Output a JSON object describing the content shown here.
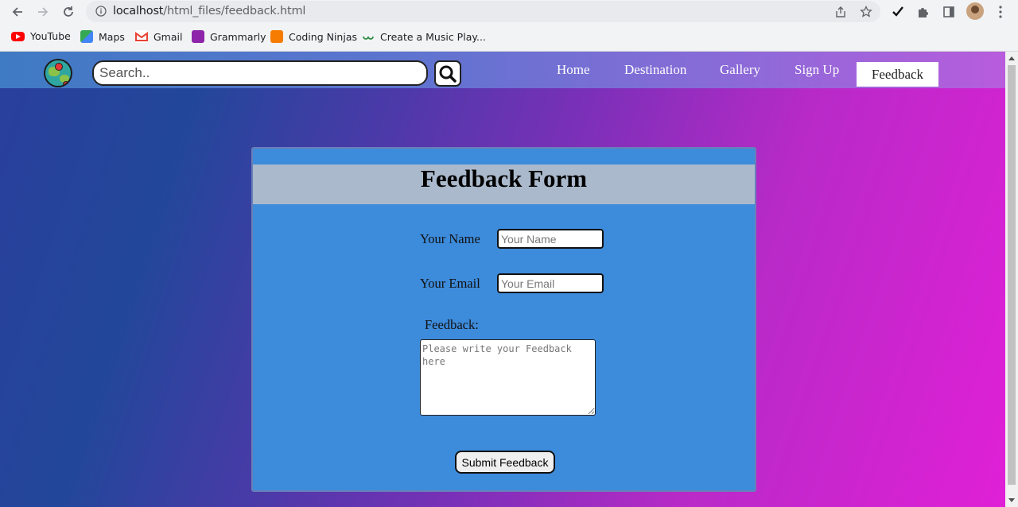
{
  "browser": {
    "url_host": "localhost",
    "url_path": "/html_files/feedback.html",
    "bookmarks": [
      {
        "label": "YouTube",
        "icon": "youtube-icon",
        "color": "#ff0000"
      },
      {
        "label": "Maps",
        "icon": "maps-icon",
        "color": "#34a853"
      },
      {
        "label": "Gmail",
        "icon": "gmail-icon",
        "color": "#ea4335"
      },
      {
        "label": "Grammarly",
        "icon": "grammarly-icon",
        "color": "#8e24aa"
      },
      {
        "label": "Coding Ninjas",
        "icon": "coding-ninjas-icon",
        "color": "#f57c00"
      },
      {
        "label": "Create a Music Play...",
        "icon": "gfg-icon",
        "color": "#2f8d46"
      }
    ]
  },
  "navbar": {
    "search_placeholder": "Search..",
    "links": [
      "Home",
      "Destination",
      "Gallery",
      "Sign Up",
      "Feedback"
    ],
    "active": "Feedback"
  },
  "form": {
    "title": "Feedback Form",
    "name_label": "Your Name",
    "name_placeholder": "Your Name",
    "email_label": "Your Email",
    "email_placeholder": "Your Email",
    "feedback_label": "Feedback:",
    "feedback_placeholder": "Please write your Feedback here",
    "submit_label": "Submit Feedback"
  },
  "colors": {
    "card_bg": "#3d8bdb",
    "header_bg": "#aab9cc",
    "navbar_start": "#3f7ac4",
    "navbar_end": "#b85cdc",
    "page_gradient_start": "#2a3f9c",
    "page_gradient_end": "#e020d6"
  }
}
